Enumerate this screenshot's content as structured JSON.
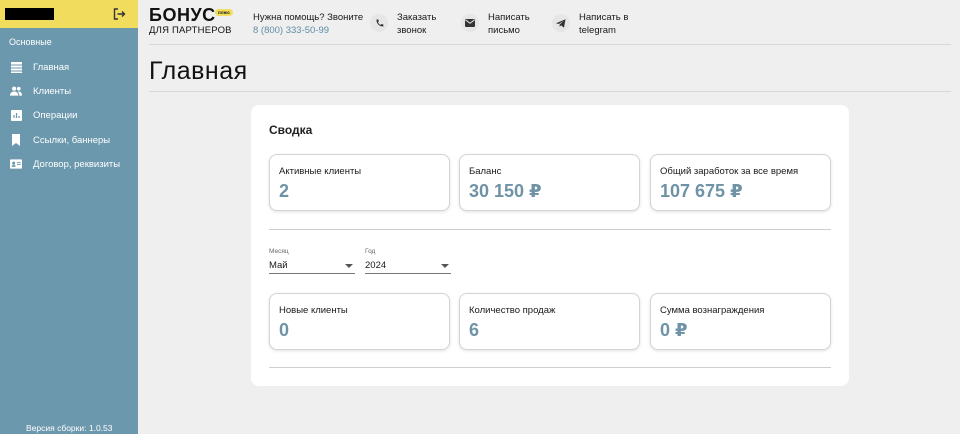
{
  "sidebar": {
    "section_label": "Основные",
    "items": [
      {
        "label": "Главная",
        "icon": "list-icon"
      },
      {
        "label": "Клиенты",
        "icon": "people-icon"
      },
      {
        "label": "Операции",
        "icon": "chart-icon"
      },
      {
        "label": "Ссылки, баннеры",
        "icon": "bookmark-icon"
      },
      {
        "label": "Договор, реквизиты",
        "icon": "id-card-icon"
      }
    ],
    "version": "Версия сборки: 1.0.53"
  },
  "header": {
    "logo_main": "БОНУС",
    "logo_badge": "плюс",
    "logo_sub": "ДЛЯ ПАРТНЕРОВ",
    "help_question": "Нужна помощь? Звоните",
    "help_phone": "8 (800) 333-50-99",
    "call_line1": "Заказать",
    "call_line2": "звонок",
    "mail_line1": "Написать",
    "mail_line2": "письмо",
    "tg_line1": "Написать в",
    "tg_line2": "telegram"
  },
  "page_title": "Главная",
  "summary": {
    "title": "Сводка",
    "totals": [
      {
        "label": "Активные клиенты",
        "value": "2"
      },
      {
        "label": "Баланс",
        "value": "30 150 ₽"
      },
      {
        "label": "Общий заработок за все время",
        "value": "107 675 ₽"
      }
    ],
    "month_caption": "Месяц",
    "month_value": "Май",
    "year_caption": "Год",
    "year_value": "2024",
    "period": [
      {
        "label": "Новые клиенты",
        "value": "0"
      },
      {
        "label": "Количество продаж",
        "value": "6"
      },
      {
        "label": "Сумма вознаграждения",
        "value": "0 ₽"
      }
    ]
  },
  "colors": {
    "accent_yellow": "#f2dc5d",
    "sidebar": "#6b98ad",
    "value_text": "#6f93a6",
    "link": "#5d8ea6"
  }
}
